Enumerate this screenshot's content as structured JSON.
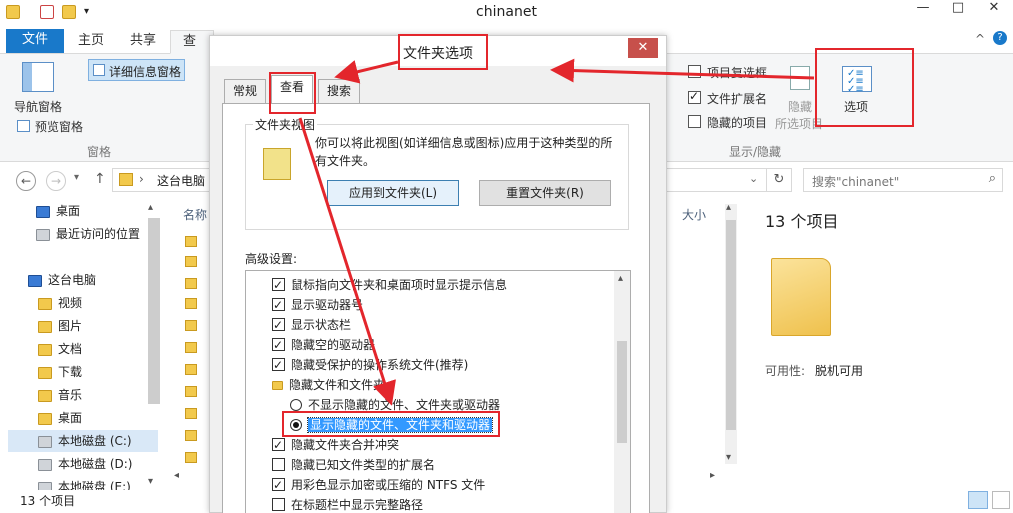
{
  "window": {
    "title": "chinanet",
    "min": "—",
    "max": "□",
    "close": "✕"
  },
  "ribbon_tabs": [
    "文件",
    "主页",
    "共享",
    "查看"
  ],
  "ribbon": {
    "nav_pane": "导航窗格",
    "preview_pane": "预览窗格",
    "details_pane": "详细信息窗格",
    "group_pane": "窗格",
    "item_checkboxes": "项目复选框",
    "file_extensions": "文件扩展名",
    "hidden_items": "隐藏的项目",
    "hide_selected_1": "隐藏",
    "hide_selected_2": "所选项目",
    "group_show_hide": "显示/隐藏",
    "options": "选项",
    "item_checkboxes_checked": false,
    "file_extensions_checked": true,
    "hidden_items_checked": false
  },
  "address": {
    "path": "这台电脑",
    "search_placeholder": "搜索\"chinanet\""
  },
  "nav": [
    {
      "label": "桌面",
      "icon": "desktop-icon"
    },
    {
      "label": "最近访问的位置",
      "icon": "recent-icon"
    },
    {
      "label": "这台电脑",
      "icon": "pc-icon"
    },
    {
      "label": "视频",
      "icon": "folder-icon"
    },
    {
      "label": "图片",
      "icon": "folder-icon"
    },
    {
      "label": "文档",
      "icon": "folder-icon"
    },
    {
      "label": "下载",
      "icon": "folder-icon"
    },
    {
      "label": "音乐",
      "icon": "folder-icon"
    },
    {
      "label": "桌面",
      "icon": "folder-icon"
    },
    {
      "label": "本地磁盘 (C:)",
      "icon": "drive-icon"
    },
    {
      "label": "本地磁盘 (D:)",
      "icon": "drive-icon"
    },
    {
      "label": "本地磁盘 (E:)",
      "icon": "drive-icon"
    }
  ],
  "columns": {
    "name": "名称",
    "size": "大小"
  },
  "details": {
    "count": "13 个项目",
    "availability_label": "可用性:",
    "availability_value": "脱机可用"
  },
  "status": {
    "count": "13 个项目"
  },
  "dialog": {
    "title": "文件夹选项",
    "close": "✕",
    "tabs": [
      "常规",
      "查看",
      "搜索"
    ],
    "folder_views_legend": "文件夹视图",
    "folder_views_desc_1": "你可以将此视图(如详细信息或图标)应用于这种类型的所",
    "folder_views_desc_2": "有文件夹。",
    "apply_button": "应用到文件夹(L)",
    "reset_button": "重置文件夹(R)",
    "advanced_label": "高级设置:",
    "advanced": [
      {
        "type": "checkbox",
        "checked": true,
        "label": "鼠标指向文件夹和桌面项时显示提示信息"
      },
      {
        "type": "checkbox",
        "checked": true,
        "label": "显示驱动器号"
      },
      {
        "type": "checkbox",
        "checked": true,
        "label": "显示状态栏"
      },
      {
        "type": "checkbox",
        "checked": true,
        "label": "隐藏空的驱动器"
      },
      {
        "type": "checkbox",
        "checked": true,
        "label": "隐藏受保护的操作系统文件(推荐)"
      },
      {
        "type": "folder",
        "label": "隐藏文件和文件夹"
      },
      {
        "type": "radio",
        "checked": false,
        "label": "不显示隐藏的文件、文件夹或驱动器"
      },
      {
        "type": "radio",
        "checked": true,
        "label": "显示隐藏的文件、文件夹和驱动器"
      },
      {
        "type": "checkbox",
        "checked": true,
        "label": "隐藏文件夹合并冲突"
      },
      {
        "type": "checkbox",
        "checked": false,
        "label": "隐藏已知文件类型的扩展名"
      },
      {
        "type": "checkbox",
        "checked": true,
        "label": "用彩色显示加密或压缩的 NTFS 文件"
      },
      {
        "type": "checkbox",
        "checked": false,
        "label": "在标题栏中显示完整路径"
      }
    ]
  },
  "colors": {
    "accent": "#1979ca",
    "annotation": "#e3262c",
    "selection": "#3399ff"
  }
}
